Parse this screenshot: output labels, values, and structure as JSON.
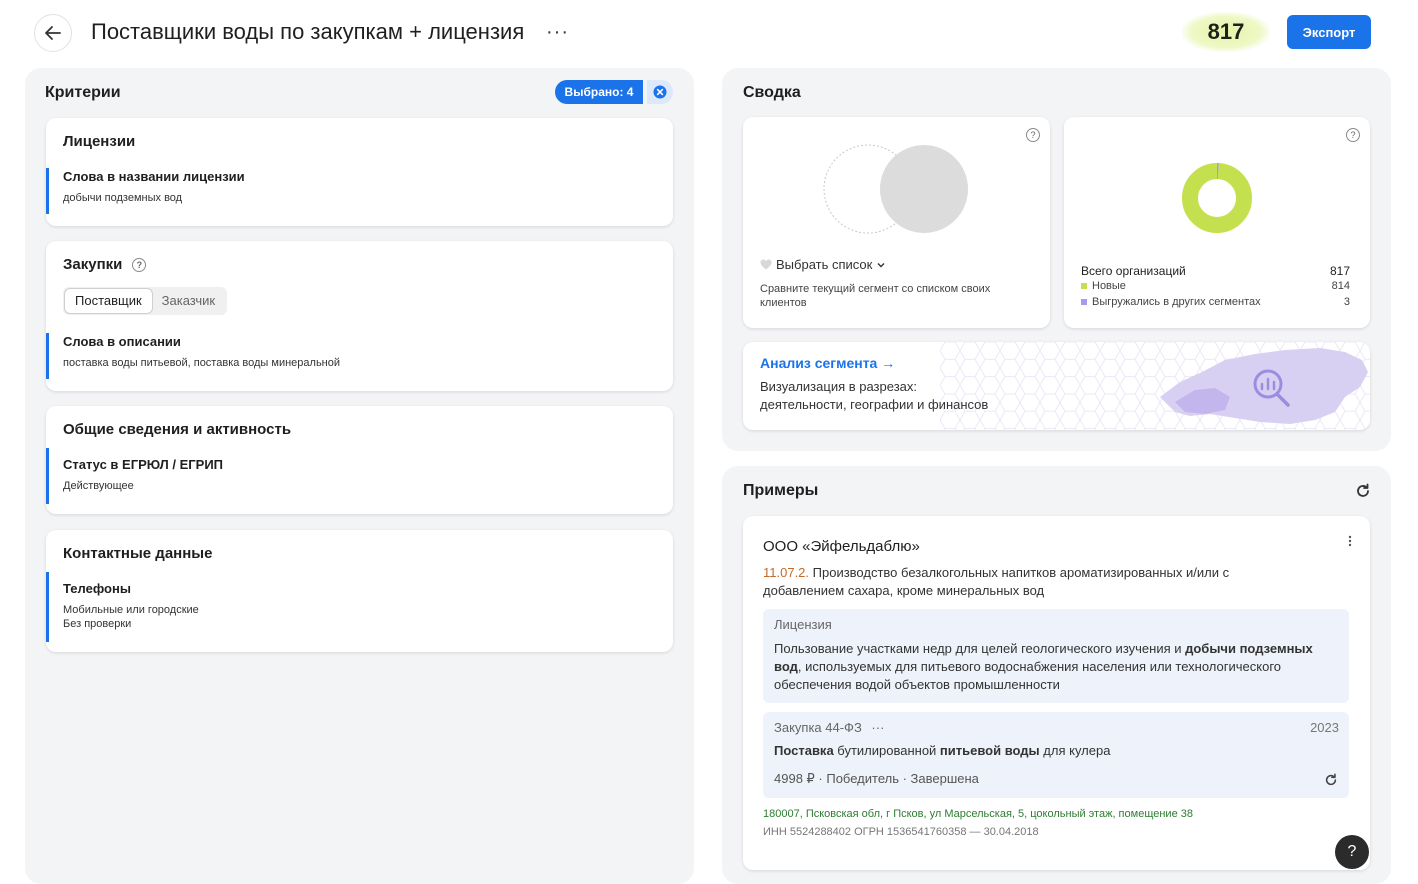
{
  "header": {
    "title": "Поставщики воды по закупкам + лицензия",
    "more": "···",
    "count": "817",
    "export_label": "Экспорт"
  },
  "criteria": {
    "title": "Критерии",
    "selected": "Выбрано: 4",
    "licenses": {
      "title": "Лицензии",
      "name": "Слова в названии лицензии",
      "value": "добычи подземных вод"
    },
    "purchases": {
      "title": "Закупки",
      "help": "?",
      "options": [
        "Поставщик",
        "Заказчик"
      ],
      "name": "Слова в описании",
      "value": "поставка воды питьевой, поставка воды минеральной"
    },
    "general": {
      "title": "Общие сведения и активность",
      "name": "Статус в ЕГРЮЛ / ЕГРИП",
      "value": "Действующее"
    },
    "contacts": {
      "title": "Контактные данные",
      "name": "Телефоны",
      "value1": "Мобильные или городские",
      "value2": "Без проверки"
    }
  },
  "summary": {
    "title": "Сводка",
    "compare": {
      "select_label": "Выбрать список",
      "description": "Сравните текущий сегмент со списком своих клиентов"
    },
    "orgs": {
      "total_label": "Всего организаций",
      "total_value": "817",
      "new_label": "Новые",
      "new_value": "814",
      "exported_label": "Выгружались в других сегментах",
      "exported_value": "3",
      "new_color": "#c5e04f",
      "exported_color": "#a99af0"
    },
    "analysis": {
      "title": "Анализ сегмента →",
      "line1": "Визуализация в разрезах:",
      "line2": "деятельности, географии и финансов"
    }
  },
  "examples": {
    "title": "Примеры",
    "company": "ООО «Эйфельдаблю»",
    "okved_code": "11.07.2.",
    "okved_text": " Производство безалкогольных напитков ароматизированных и/или с добавлением сахара, кроме минеральных вод",
    "license_label": "Лицензия",
    "license_text_1": "Пользование участками недр для целей геологического изучения и ",
    "license_bold": "добычи подземных вод",
    "license_text_2": ", используемых для питьевого водоснабжения населения или технологического обеспечения водой объектов промышленности",
    "purchase_label": "Закупка 44-ФЗ",
    "purchase_more": "···",
    "purchase_year": "2023",
    "purchase_b1": "Поставка",
    "purchase_t1": " бутилированной ",
    "purchase_b2": "питьевой воды",
    "purchase_t2": " для кулера",
    "purchase_meta": "4998 ₽  ·  Победитель  ·  Завершена",
    "address": "180007, Псковская обл, г Псков, ул Марсельская, 5, цокольный этаж, помещение 38",
    "ids": "ИНН 5524288402    ОГРН 1536541760358 — 30.04.2018"
  },
  "help_fab": "?"
}
